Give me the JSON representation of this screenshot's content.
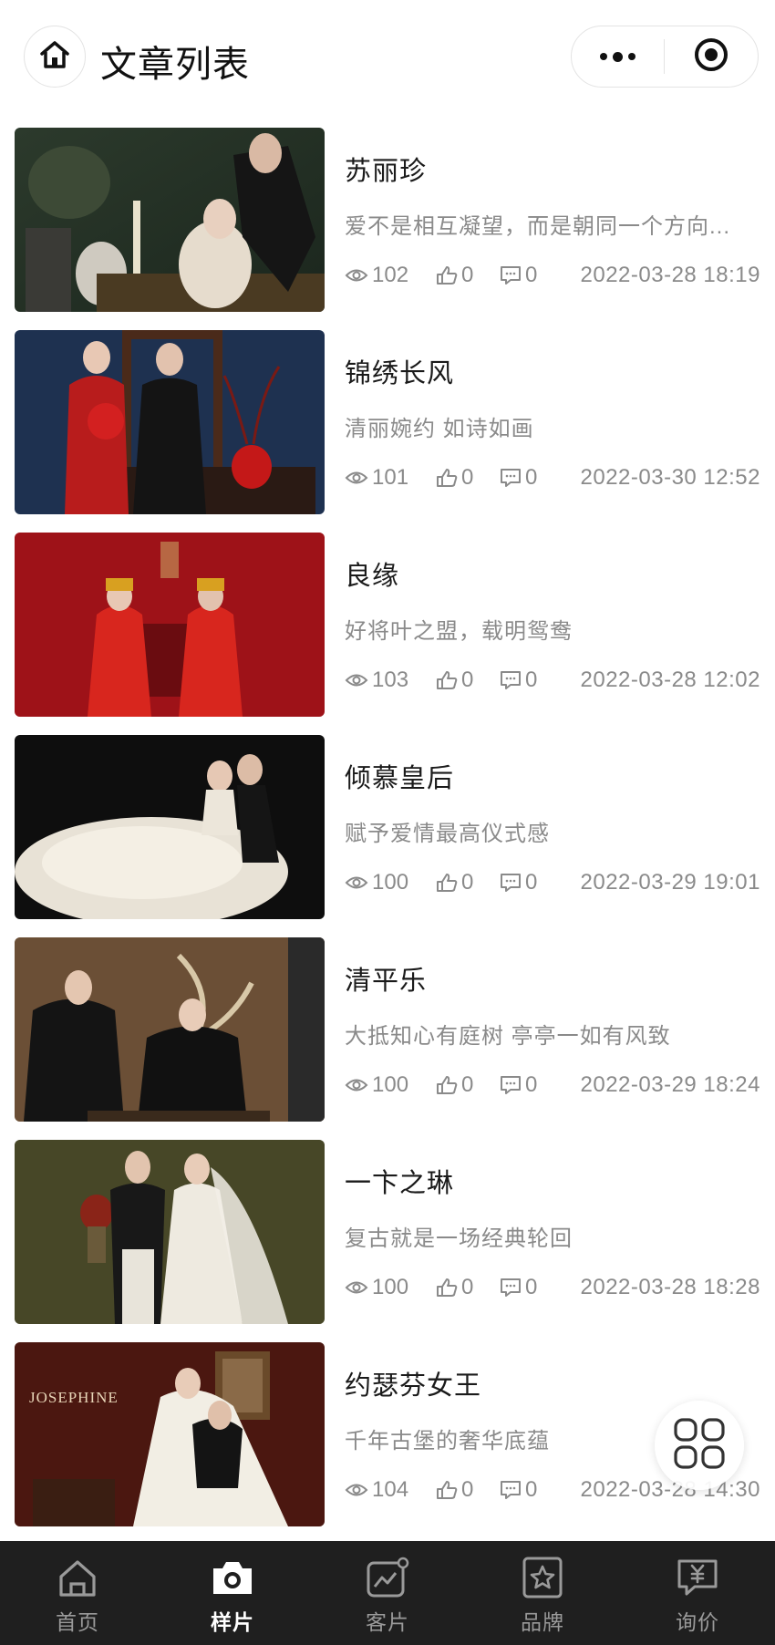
{
  "header": {
    "title": "文章列表"
  },
  "articles": [
    {
      "title": "苏丽珍",
      "desc": "爱不是相互凝望，而是朝同一个方向...",
      "views": "102",
      "likes": "0",
      "comments": "0",
      "date": "2022-03-28 18:19"
    },
    {
      "title": "锦绣长风",
      "desc": "清丽婉约 如诗如画",
      "views": "101",
      "likes": "0",
      "comments": "0",
      "date": "2022-03-30 12:52"
    },
    {
      "title": "良缘",
      "desc": "好将叶之盟，载明鸳鸯",
      "views": "103",
      "likes": "0",
      "comments": "0",
      "date": "2022-03-28 12:02"
    },
    {
      "title": "倾慕皇后",
      "desc": "赋予爱情最高仪式感",
      "views": "100",
      "likes": "0",
      "comments": "0",
      "date": "2022-03-29 19:01"
    },
    {
      "title": "清平乐",
      "desc": "大抵知心有庭树 亭亭一如有风致",
      "views": "100",
      "likes": "0",
      "comments": "0",
      "date": "2022-03-29 18:24"
    },
    {
      "title": "一卞之琳",
      "desc": "复古就是一场经典轮回",
      "views": "100",
      "likes": "0",
      "comments": "0",
      "date": "2022-03-28 18:28"
    },
    {
      "title": "约瑟芬女王",
      "desc": "千年古堡的奢华底蕴",
      "views": "104",
      "likes": "0",
      "comments": "0",
      "date": "2022-03-28 14:30",
      "image_text": "JOSEPHINE"
    }
  ],
  "tabbar": {
    "tabs": [
      {
        "label": "首页",
        "icon": "home-icon"
      },
      {
        "label": "样片",
        "icon": "camera-icon"
      },
      {
        "label": "客片",
        "icon": "photo-chart-icon"
      },
      {
        "label": "品牌",
        "icon": "star-icon"
      },
      {
        "label": "询价",
        "icon": "yuan-chat-icon"
      }
    ],
    "active": "样片",
    "active_color": "#ffffff",
    "inactive_color": "#9a9a9a"
  }
}
